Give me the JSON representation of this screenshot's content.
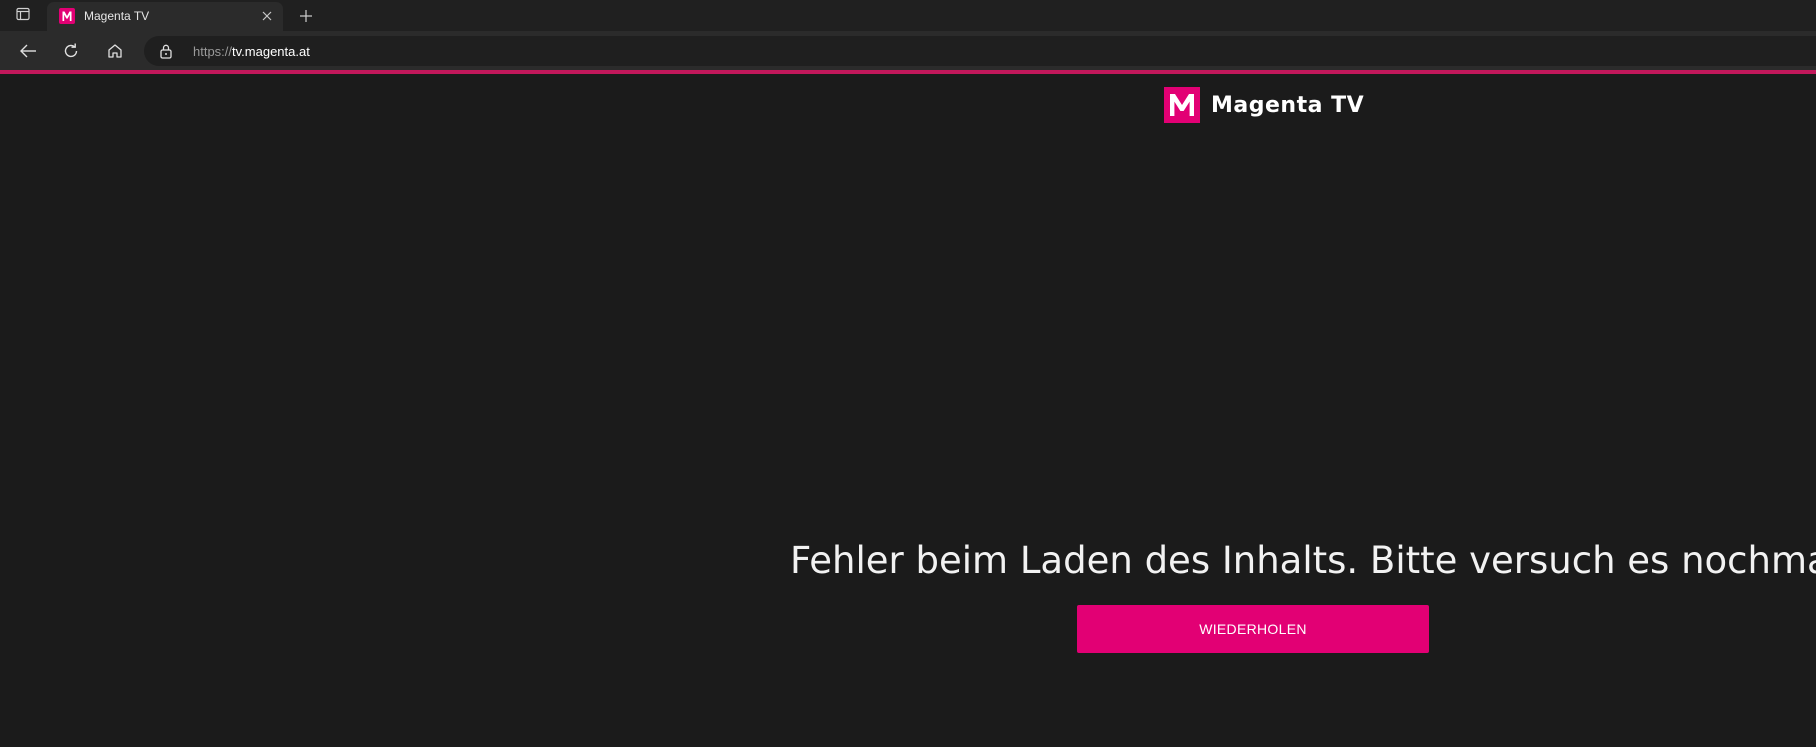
{
  "browser": {
    "tab": {
      "title": "Magenta TV",
      "favicon_letter": "M",
      "favicon_color": "#e20074"
    },
    "address_bar": {
      "scheme": "https://",
      "host": "tv.magenta.at"
    },
    "icons": {
      "tab_actions": "tab-actions-icon",
      "close": "close-icon",
      "new_tab": "plus-icon",
      "back": "back-arrow-icon",
      "refresh": "refresh-icon",
      "home": "home-icon",
      "lock": "lock-icon"
    },
    "accent_line_color": "#c2185b"
  },
  "page": {
    "brand": {
      "logo_letter": "M",
      "name": "Magenta TV",
      "color": "#e20074"
    },
    "error": {
      "message": "Fehler beim Laden des Inhalts. Bitte versuch es nochmals."
    },
    "retry_button": {
      "label": "WIEDERHOLEN",
      "color": "#e20074"
    },
    "background_color": "#1b1b1b"
  }
}
